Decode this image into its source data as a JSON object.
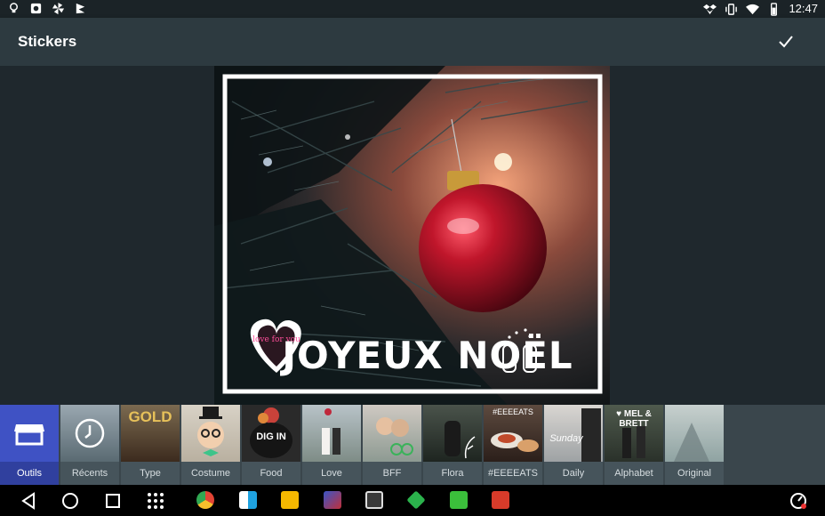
{
  "status_bar": {
    "time": "12:47",
    "left_icons": [
      "lightbulb-icon",
      "image-icon",
      "pinwheel-icon",
      "flag-icon"
    ],
    "right_icons": [
      "dropbox-icon",
      "vibrate-icon",
      "wifi-icon",
      "battery-icon"
    ]
  },
  "toolbar": {
    "title": "Stickers",
    "confirm_icon": "check-icon"
  },
  "photo": {
    "sticker_text": "JOYEUX NOËL",
    "heart_text": "love for you",
    "frame_color": "#ffffff"
  },
  "sticker_packs": [
    {
      "label": "Outils",
      "icon": "shop-icon",
      "selected": true
    },
    {
      "label": "Récents",
      "icon": "clock-icon"
    },
    {
      "label": "Type",
      "thumb_text": "GOLD"
    },
    {
      "label": "Costume"
    },
    {
      "label": "Food",
      "thumb_text": "DIG IN"
    },
    {
      "label": "Love"
    },
    {
      "label": "BFF"
    },
    {
      "label": "Flora"
    },
    {
      "label": "#EEEEATS",
      "thumb_text": "#EEEEATS"
    },
    {
      "label": "Daily",
      "thumb_text": "Sunday"
    },
    {
      "label": "Alphabet",
      "thumb_text": "♥ MEL & BRETT"
    },
    {
      "label": "Original"
    }
  ],
  "nav_bar": {
    "buttons": [
      "back-icon",
      "home-icon",
      "recents-icon",
      "apps-grid-icon"
    ],
    "apps": [
      "chrome-app-icon",
      "windows-app-icon",
      "keep-app-icon",
      "game-app-icon",
      "tablet-app-icon",
      "feedly-app-icon",
      "camera-app-icon",
      "office-app-icon"
    ],
    "right_icon": "speedometer-icon"
  },
  "colors": {
    "accent": "#3f52c4",
    "toolbar": "#2d3a40",
    "background": "#1f272c",
    "ornament": "#b01a2a"
  }
}
